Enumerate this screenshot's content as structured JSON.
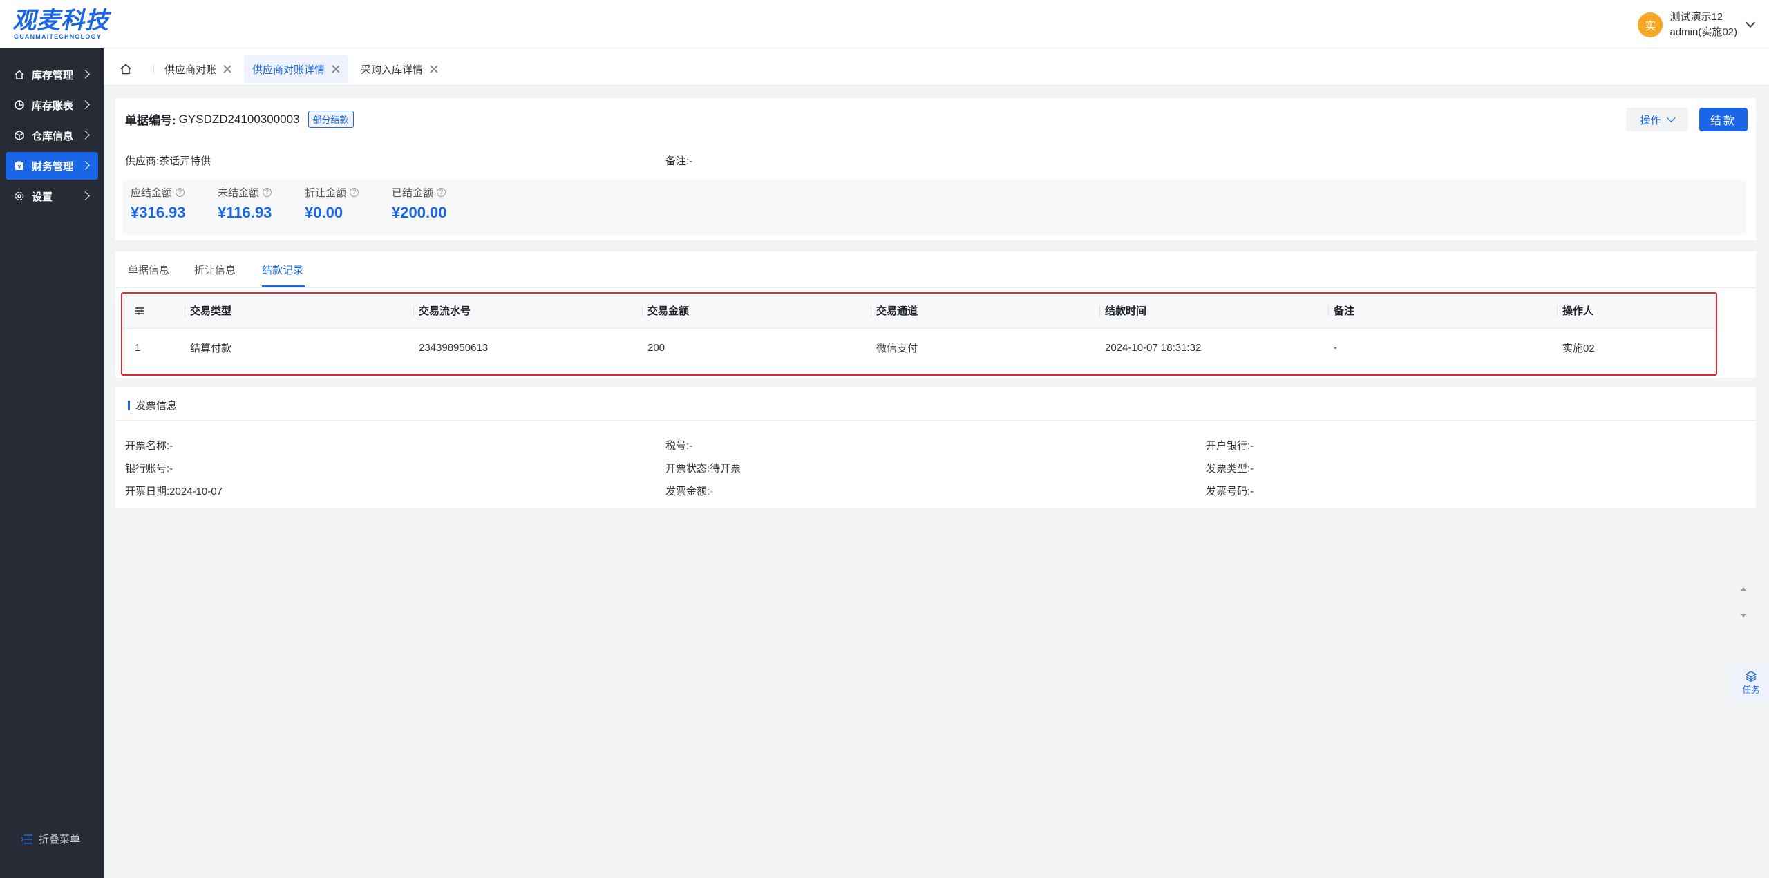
{
  "brand": {
    "name_cn": "观麦科技",
    "name_en": "GUANMAITECHNOLOGY"
  },
  "user": {
    "avatar_char": "实",
    "name": "测试演示12",
    "account": "admin(实施02)"
  },
  "sidebar": {
    "items": [
      {
        "label": "库存管理",
        "icon": "home-icon"
      },
      {
        "label": "库存账表",
        "icon": "pie-chart-icon"
      },
      {
        "label": "仓库信息",
        "icon": "cube-icon"
      },
      {
        "label": "财务管理",
        "icon": "finance-icon",
        "active": true
      },
      {
        "label": "设置",
        "icon": "gear-icon"
      }
    ],
    "collapse_label": "折叠菜单"
  },
  "tabs": [
    {
      "label": "供应商对账"
    },
    {
      "label": "供应商对账详情",
      "active": true
    },
    {
      "label": "采购入库详情"
    }
  ],
  "doc": {
    "number_label": "单据编号:",
    "number": "GYSDZD24100300003",
    "status": "部分结款",
    "operate_label": "操作",
    "settle_label": "结款",
    "supplier_label": "供应商:",
    "supplier": "茶话弄特供",
    "remark_label": "备注:",
    "remark": "-",
    "amounts": [
      {
        "label": "应结金额",
        "value": "¥316.93"
      },
      {
        "label": "未结金额",
        "value": "¥116.93"
      },
      {
        "label": "折让金额",
        "value": "¥0.00"
      },
      {
        "label": "已结金额",
        "value": "¥200.00"
      }
    ]
  },
  "record_tabs": [
    {
      "label": "单据信息"
    },
    {
      "label": "折让信息"
    },
    {
      "label": "结款记录",
      "active": true
    }
  ],
  "table": {
    "columns": [
      "交易类型",
      "交易流水号",
      "交易金额",
      "交易通道",
      "结款时间",
      "备注",
      "操作人"
    ],
    "rows": [
      {
        "index": "1",
        "cells": [
          "结算付款",
          "234398950613",
          "200",
          "微信支付",
          "2024-10-07 18:31:32",
          "-",
          "实施02"
        ]
      }
    ]
  },
  "invoice": {
    "title": "发票信息",
    "fields": [
      {
        "label": "开票名称:",
        "value": "-"
      },
      {
        "label": "税号:",
        "value": "-"
      },
      {
        "label": "开户银行:",
        "value": "-"
      },
      {
        "label": "银行账号:",
        "value": "-"
      },
      {
        "label": "开票状态:",
        "value": "待开票"
      },
      {
        "label": "发票类型:",
        "value": "-"
      },
      {
        "label": "开票日期:",
        "value": "2024-10-07"
      },
      {
        "label": "发票金额:",
        "value": "-"
      },
      {
        "label": "发票号码:",
        "value": "-"
      }
    ]
  },
  "task_float": {
    "label": "任务"
  },
  "colors": {
    "primary": "#1a66e6",
    "sidebar": "#272b36",
    "highlight": "#e8262d",
    "avatar": "#f5a623"
  }
}
